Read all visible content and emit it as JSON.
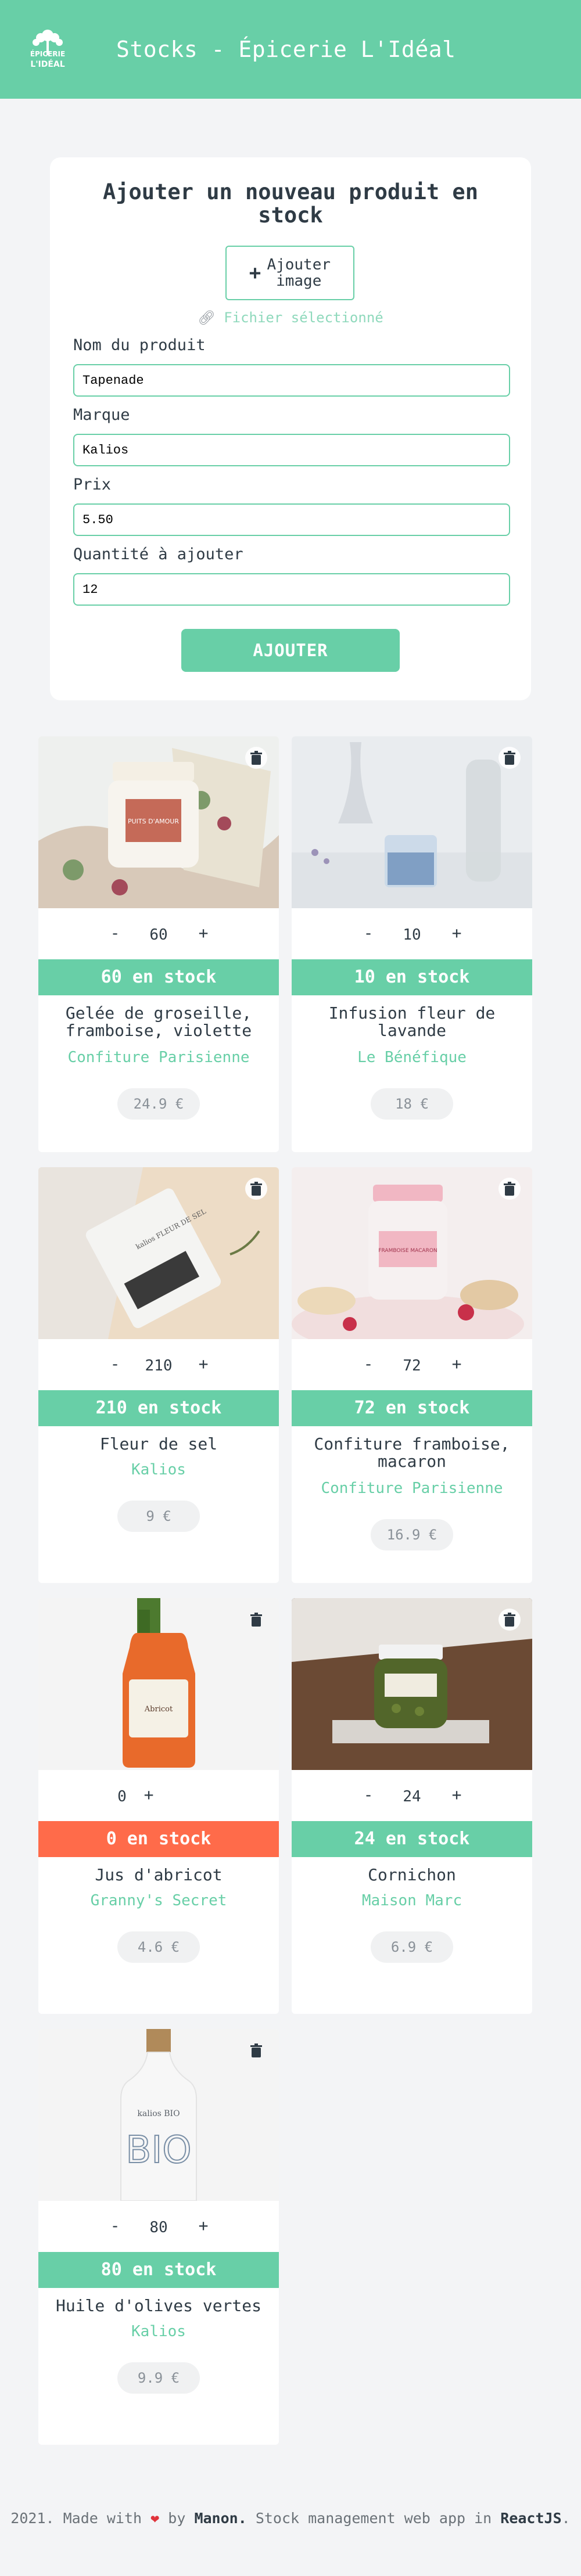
{
  "header": {
    "title": "Stocks - Épicerie L'Idéal",
    "logo_text": [
      "ÉPICERIE",
      "L'IDÉAL"
    ]
  },
  "form": {
    "title": "Ajouter un nouveau produit en stock",
    "add_image_label": "Ajouter image",
    "file_selected": "Fichier sélectionné",
    "fields": [
      {
        "label": "Nom du produit",
        "value": "Tapenade"
      },
      {
        "label": "Marque",
        "value": "Kalios"
      },
      {
        "label": "Prix",
        "value": "5.50"
      },
      {
        "label": "Quantité à ajouter",
        "value": "12"
      }
    ],
    "submit_label": "AJOUTER"
  },
  "products": [
    {
      "qty": "60",
      "stock": "60 en stock",
      "name": "Gelée de groseille, framboise, violette",
      "brand": "Confiture Parisienne",
      "price": "24.9 €",
      "label_text": "PUITS D'AMOUR"
    },
    {
      "qty": "10",
      "stock": "10 en stock",
      "name": "Infusion fleur de lavande",
      "brand": "Le Bénéfique",
      "price": "18 €"
    },
    {
      "qty": "210",
      "stock": "210 en stock",
      "name": "Fleur de sel",
      "brand": "Kalios",
      "price": "9 €",
      "label_text": "kalios FLEUR DE SEL"
    },
    {
      "qty": "72",
      "stock": "72 en stock",
      "name": "Confiture framboise, macaron",
      "brand": "Confiture Parisienne",
      "price": "16.9 €",
      "label_text": "FRAMBOISE MACARON"
    },
    {
      "qty": "0",
      "stock": "0 en stock",
      "name": "Jus d'abricot",
      "brand": "Granny's Secret",
      "price": "4.6 €",
      "label_text": "Abricot"
    },
    {
      "qty": "24",
      "stock": "24 en stock",
      "name": "Cornichon",
      "brand": "Maison Marc",
      "price": "6.9 €"
    },
    {
      "qty": "80",
      "stock": "80 en stock",
      "name": "Huile d'olives vertes",
      "brand": "Kalios",
      "price": "9.9 €",
      "label_text": "kalios BIO"
    }
  ],
  "stepper": {
    "minus": "-",
    "plus": "+"
  },
  "footer": {
    "prefix": "2021. Made with",
    "heart": "❤",
    "by": "by",
    "author": "Manon.",
    "middle": "Stock management web app in",
    "tech": "ReactJS",
    "end": "."
  },
  "colors": {
    "accent": "#68cfa7",
    "out_of_stock": "#ff6b4a",
    "text": "#2f3b45"
  }
}
